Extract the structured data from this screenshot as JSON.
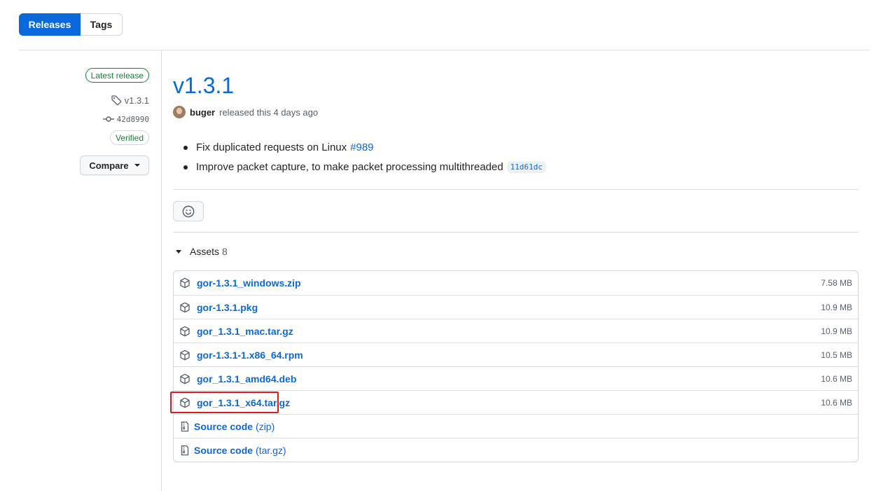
{
  "tabs": {
    "releases": "Releases",
    "tags": "Tags"
  },
  "sidebar": {
    "latest_badge": "Latest release",
    "tag": "v1.3.1",
    "commit": "42d8990",
    "verified": "Verified",
    "compare": "Compare"
  },
  "release": {
    "title": "v1.3.1",
    "author": "buger",
    "released_text": "released this 4 days ago",
    "notes": [
      {
        "text": "Fix duplicated requests on Linux",
        "link": "#989"
      },
      {
        "text": "Improve packet capture, to make packet processing multithreaded",
        "sha": "11d61dc"
      }
    ]
  },
  "assets": {
    "label": "Assets",
    "count": "8",
    "items": [
      {
        "name": "gor-1.3.1_windows.zip",
        "size": "7.58 MB"
      },
      {
        "name": "gor-1.3.1.pkg",
        "size": "10.9 MB"
      },
      {
        "name": "gor_1.3.1_mac.tar.gz",
        "size": "10.9 MB"
      },
      {
        "name": "gor-1.3.1-1.x86_64.rpm",
        "size": "10.5 MB"
      },
      {
        "name": "gor_1.3.1_amd64.deb",
        "size": "10.6 MB"
      },
      {
        "name": "gor_1.3.1_x64.tar.gz",
        "size": "10.6 MB"
      }
    ],
    "source": [
      {
        "name": "Source code",
        "suffix": "(zip)"
      },
      {
        "name": "Source code",
        "suffix": "(tar.gz)"
      }
    ]
  },
  "colors": {
    "accent": "#0969da",
    "success": "#1a7f37",
    "highlight": "#e5171c"
  }
}
